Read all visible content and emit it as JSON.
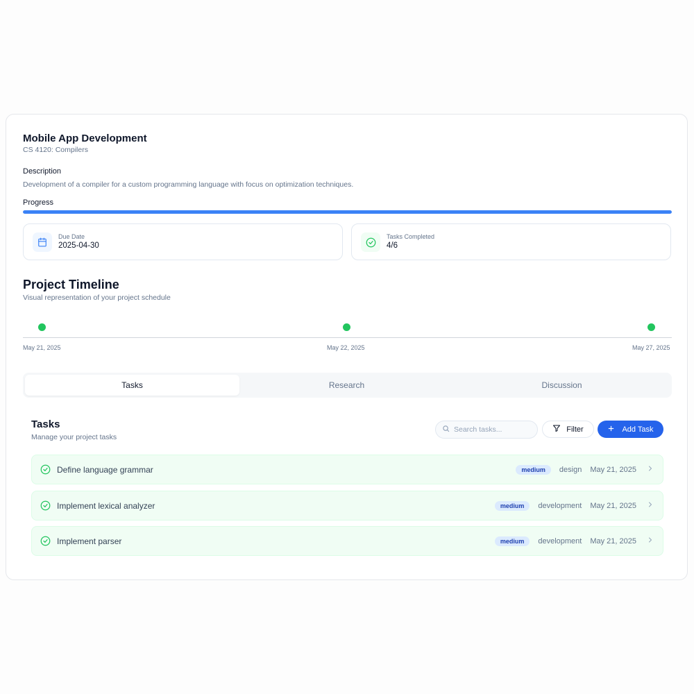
{
  "project": {
    "title": "Mobile App Development",
    "course": "CS 4120: Compilers",
    "description_label": "Description",
    "description": "Development of a compiler for a custom programming language with focus on optimization techniques.",
    "progress_label": "Progress",
    "progress_fraction": 1.0
  },
  "stats": {
    "due": {
      "label": "Due Date",
      "value": "2025-04-30",
      "icon": "calendar-icon"
    },
    "tasks": {
      "label": "Tasks Completed",
      "value": "4/6",
      "icon": "check-circle-icon"
    }
  },
  "timeline": {
    "title": "Project Timeline",
    "subtitle": "Visual representation of your project schedule",
    "dates": [
      "May 21, 2025",
      "May 22, 2025",
      "May 27, 2025"
    ]
  },
  "tabs": [
    {
      "label": "Tasks",
      "active": true
    },
    {
      "label": "Research",
      "active": false
    },
    {
      "label": "Discussion",
      "active": false
    }
  ],
  "tasks_panel": {
    "title": "Tasks",
    "subtitle": "Manage your project tasks",
    "search_placeholder": "Search tasks...",
    "filter_label": "Filter",
    "add_label": "Add Task"
  },
  "tasks": [
    {
      "name": "Define language grammar",
      "priority": "medium",
      "category": "design",
      "date": "May 21, 2025"
    },
    {
      "name": "Implement lexical analyzer",
      "priority": "medium",
      "category": "development",
      "date": "May 21, 2025"
    },
    {
      "name": "Implement parser",
      "priority": "medium",
      "category": "development",
      "date": "May 21, 2025"
    }
  ],
  "colors": {
    "accent": "#2563eb",
    "progress": "#3b82f6",
    "success": "#22c55e",
    "task_bg": "#f0fdf4",
    "badge_bg": "#dbeafe"
  }
}
